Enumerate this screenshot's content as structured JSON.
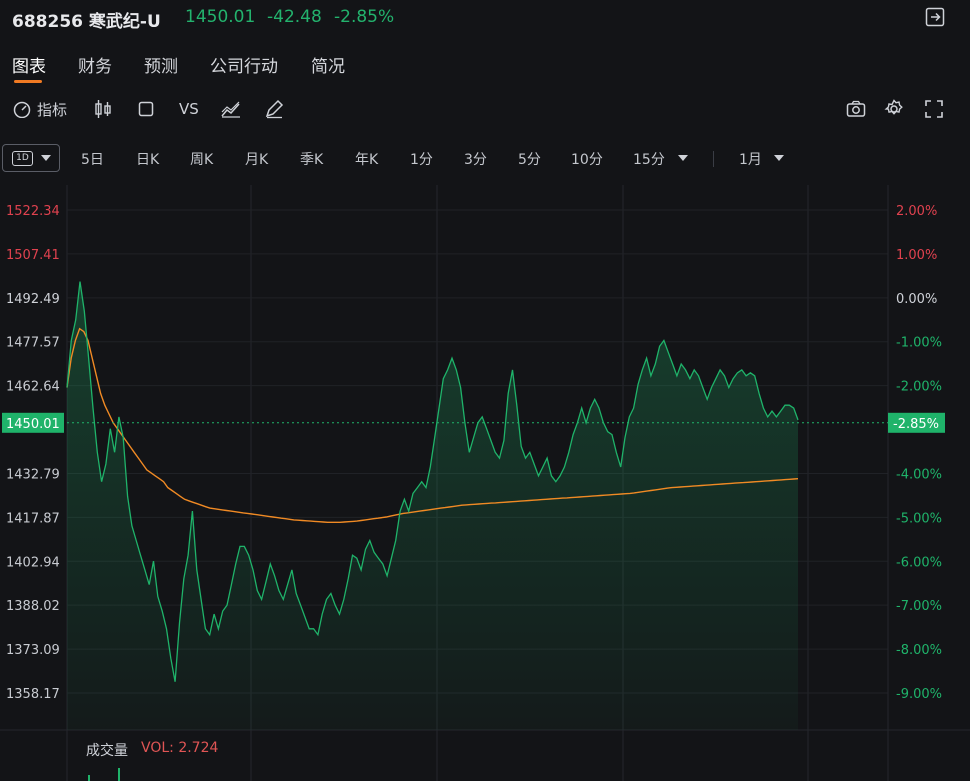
{
  "header": {
    "code": "688256",
    "name": "寒武纪-U",
    "price": "1450.01",
    "change": "-42.48",
    "change_pct": "-2.85%"
  },
  "tabs": [
    {
      "label": "图表",
      "active": true
    },
    {
      "label": "财务",
      "active": false
    },
    {
      "label": "预测",
      "active": false
    },
    {
      "label": "公司行动",
      "active": false
    },
    {
      "label": "简况",
      "active": false
    }
  ],
  "toolbar": {
    "indicator_label": "指标",
    "vs_label": "VS"
  },
  "periods": {
    "selected": "1D",
    "items": [
      "5日",
      "日K",
      "周K",
      "月K",
      "季K",
      "年K",
      "1分",
      "3分",
      "5分",
      "10分",
      "15分"
    ],
    "range": "1月"
  },
  "chart_data": {
    "type": "line",
    "price_ticks": [
      "1522.34",
      "1507.41",
      "1492.49",
      "1477.57",
      "1462.64",
      "1432.79",
      "1417.87",
      "1402.94",
      "1388.02",
      "1373.09",
      "1358.17"
    ],
    "pct_ticks": [
      "2.00%",
      "1.00%",
      "0.00%",
      "-1.00%",
      "-2.00%",
      "-4.00%",
      "-5.00%",
      "-6.00%",
      "-7.00%",
      "-8.00%",
      "-9.00%"
    ],
    "current_price_label": "1450.01",
    "current_pct_label": "-2.85%",
    "prev_close": 1492.49,
    "ylim": [
      1350,
      1530
    ],
    "colors": {
      "price": "#1fb36a",
      "avg": "#f08a24",
      "up": "#f23645",
      "down": "#1fb36a"
    },
    "price_series": [
      1462,
      1478,
      1485,
      1498,
      1488,
      1472,
      1455,
      1440,
      1430,
      1436,
      1448,
      1440,
      1452,
      1445,
      1425,
      1415,
      1410,
      1405,
      1400,
      1395,
      1403,
      1391,
      1386,
      1380,
      1370,
      1362,
      1382,
      1397,
      1405,
      1420,
      1400,
      1390,
      1380,
      1378,
      1385,
      1380,
      1386,
      1388,
      1395,
      1402,
      1408,
      1408,
      1405,
      1400,
      1393,
      1390,
      1396,
      1402,
      1398,
      1393,
      1390,
      1395,
      1400,
      1392,
      1388,
      1384,
      1380,
      1380,
      1378,
      1385,
      1390,
      1392,
      1388,
      1385,
      1390,
      1397,
      1405,
      1404,
      1400,
      1407,
      1410,
      1406,
      1404,
      1402,
      1398,
      1404,
      1410,
      1420,
      1424,
      1420,
      1426,
      1428,
      1430,
      1428,
      1435,
      1445,
      1455,
      1465,
      1468,
      1472,
      1468,
      1462,
      1450,
      1440,
      1445,
      1450,
      1452,
      1448,
      1444,
      1440,
      1438,
      1444,
      1460,
      1468,
      1456,
      1442,
      1438,
      1440,
      1436,
      1432,
      1435,
      1438,
      1432,
      1430,
      1432,
      1435,
      1440,
      1446,
      1450,
      1455,
      1450,
      1455,
      1458,
      1455,
      1450,
      1447,
      1446,
      1440,
      1435,
      1445,
      1452,
      1455,
      1463,
      1468,
      1472,
      1466,
      1470,
      1476,
      1478,
      1474,
      1470,
      1466,
      1470,
      1468,
      1465,
      1468,
      1466,
      1462,
      1458,
      1462,
      1465,
      1468,
      1466,
      1462,
      1465,
      1467,
      1468,
      1466,
      1467,
      1466,
      1460,
      1455,
      1452,
      1454,
      1452,
      1454,
      1456,
      1456,
      1455,
      1451
    ],
    "avg_series": [
      1462,
      1472,
      1478,
      1482,
      1481,
      1478,
      1472,
      1466,
      1460,
      1456,
      1453,
      1450,
      1448,
      1446,
      1444,
      1442,
      1440,
      1438,
      1436,
      1434,
      1433,
      1432,
      1431,
      1430,
      1428,
      1427,
      1426,
      1425,
      1424,
      1423.5,
      1423,
      1422.5,
      1422,
      1421.5,
      1421,
      1420.8,
      1420.6,
      1420.4,
      1420.2,
      1420,
      1419.8,
      1419.6,
      1419.4,
      1419.2,
      1419,
      1418.8,
      1418.6,
      1418.4,
      1418.2,
      1418,
      1417.8,
      1417.6,
      1417.4,
      1417.2,
      1417,
      1416.9,
      1416.8,
      1416.7,
      1416.6,
      1416.5,
      1416.4,
      1416.3,
      1416.2,
      1416.2,
      1416.2,
      1416.2,
      1416.3,
      1416.4,
      1416.5,
      1416.6,
      1416.8,
      1417,
      1417.2,
      1417.4,
      1417.6,
      1417.8,
      1418,
      1418.3,
      1418.6,
      1418.9,
      1419.2,
      1419.4,
      1419.6,
      1419.8,
      1420,
      1420.2,
      1420.4,
      1420.6,
      1420.8,
      1421,
      1421.2,
      1421.4,
      1421.6,
      1421.8,
      1422,
      1422.1,
      1422.2,
      1422.3,
      1422.4,
      1422.5,
      1422.6,
      1422.7,
      1422.8,
      1422.9,
      1423,
      1423.1,
      1423.2,
      1423.3,
      1423.4,
      1423.5,
      1423.6,
      1423.7,
      1423.8,
      1423.9,
      1424,
      1424.1,
      1424.2,
      1424.3,
      1424.4,
      1424.5,
      1424.6,
      1424.7,
      1424.8,
      1424.9,
      1425,
      1425.1,
      1425.2,
      1425.3,
      1425.4,
      1425.5,
      1425.6,
      1425.7,
      1425.8,
      1425.9,
      1426,
      1426.2,
      1426.4,
      1426.6,
      1426.8,
      1427,
      1427.2,
      1427.4,
      1427.6,
      1427.8,
      1428,
      1428.1,
      1428.2,
      1428.3,
      1428.4,
      1428.5,
      1428.6,
      1428.7,
      1428.8,
      1428.9,
      1429,
      1429.1,
      1429.2,
      1429.3,
      1429.4,
      1429.5,
      1429.6,
      1429.7,
      1429.8,
      1429.9,
      1430,
      1430.1,
      1430.2,
      1430.3,
      1430.4,
      1430.5,
      1430.6,
      1430.7,
      1430.8,
      1430.9,
      1431
    ]
  },
  "volume": {
    "label": "成交量",
    "value_label": "VOL: 2.724"
  }
}
